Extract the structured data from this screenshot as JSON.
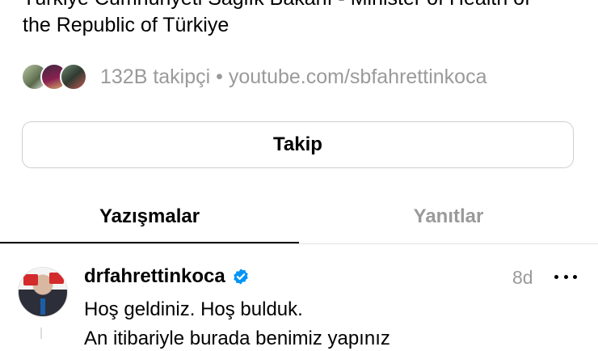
{
  "profile": {
    "bio_line1": "Türkiye Cumhuriyeti Sağlık Bakanı - Minister of Health of",
    "bio_line2": "the Republic of Türkiye",
    "followers_text": "132B takipçi • youtube.com/sbfahrettinkoca",
    "follow_label": "Takip"
  },
  "tabs": [
    {
      "label": "Yazışmalar",
      "active": true
    },
    {
      "label": "Yanıtlar",
      "active": false
    }
  ],
  "post": {
    "username": "drfahrettinkoca",
    "verified": true,
    "timestamp": "8d",
    "line1": "Hoş geldiniz. Hoş bulduk.",
    "line2": "An itibariyle burada benimiz yapınız"
  },
  "colors": {
    "verified_blue": "#0095f6",
    "muted_text": "#9a9a9a"
  },
  "icons": {
    "verified": "verified-badge-icon",
    "more": "more-horizontal-icon"
  }
}
